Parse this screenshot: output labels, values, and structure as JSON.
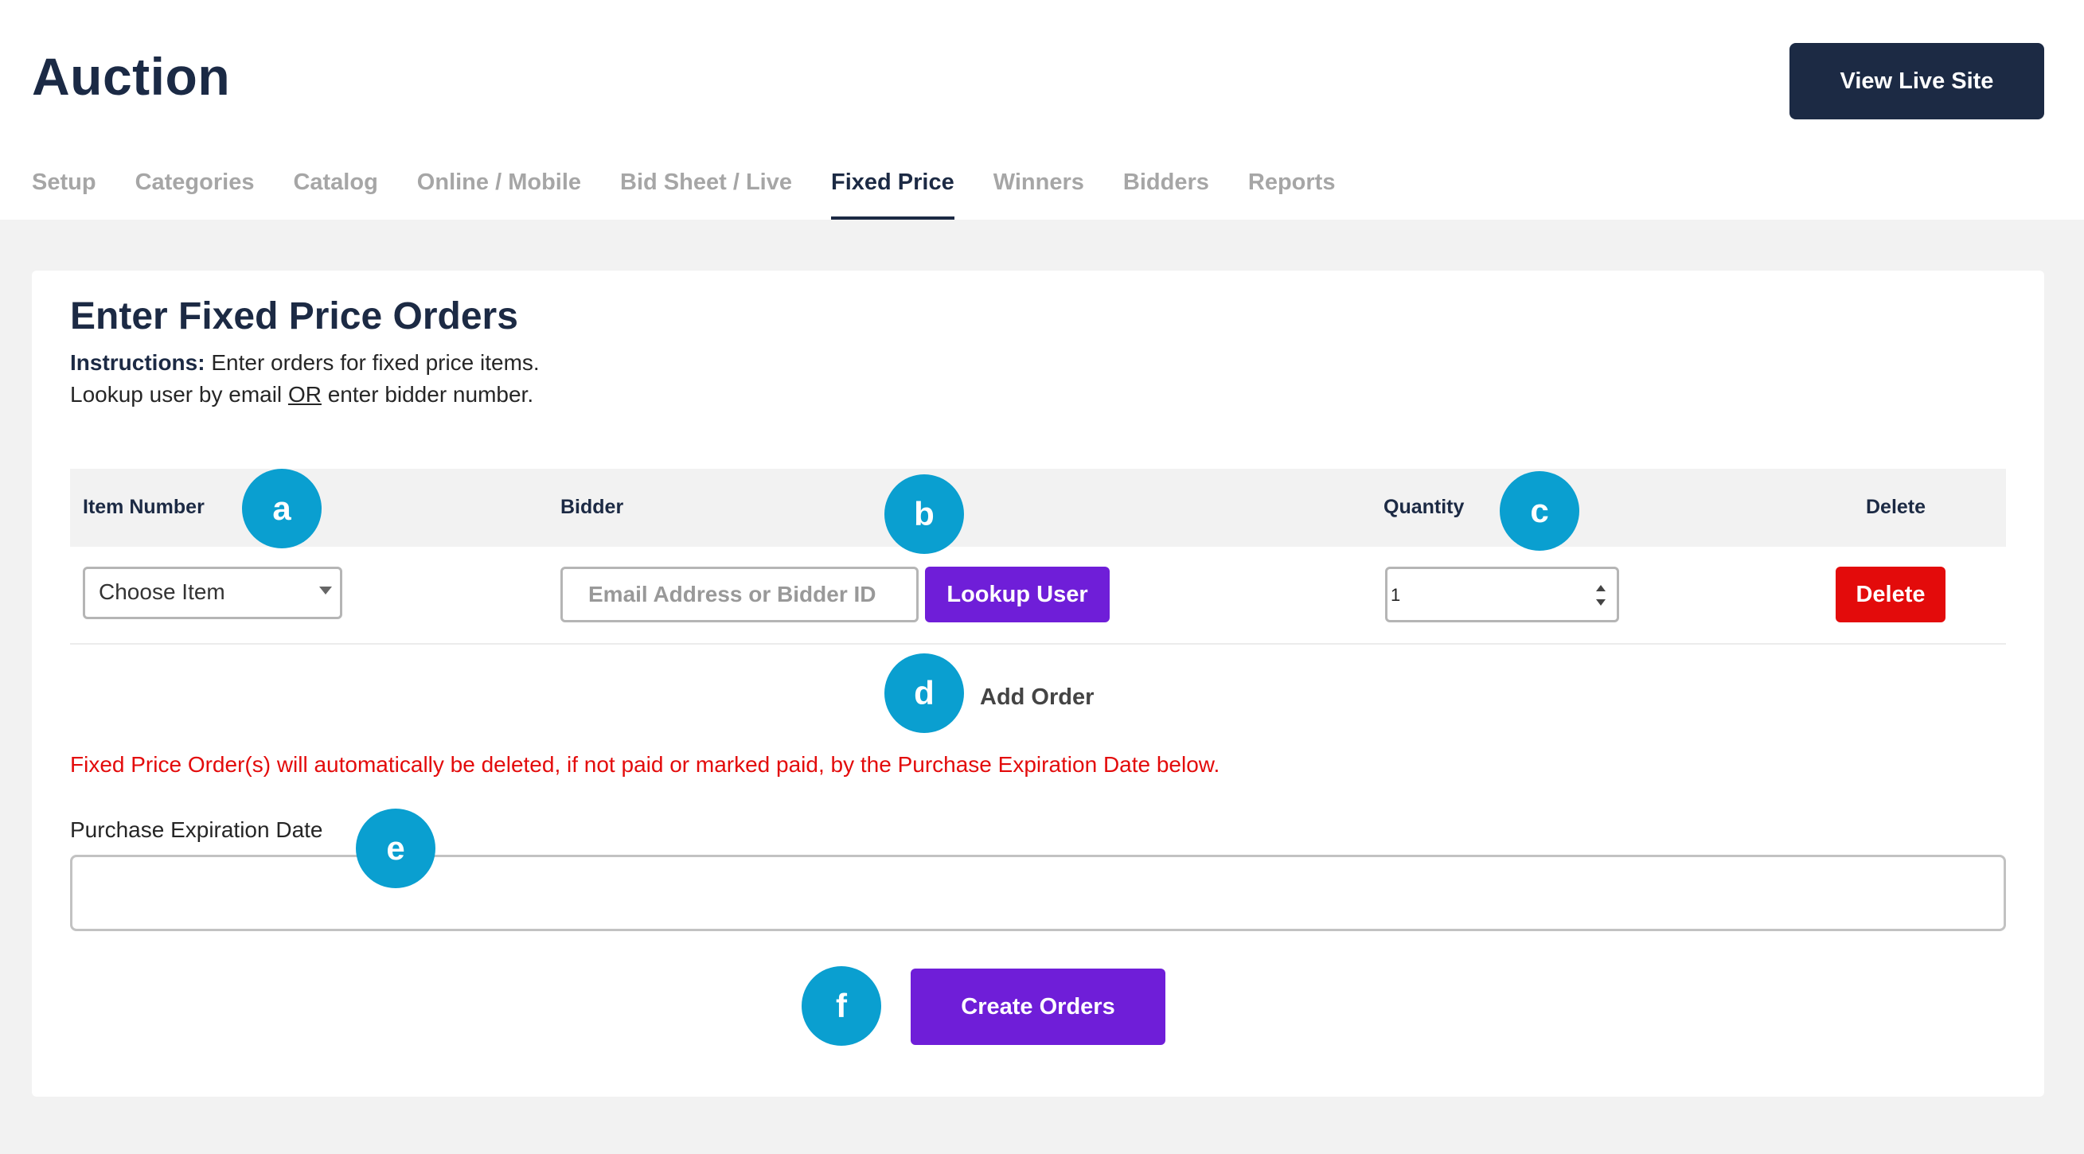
{
  "header": {
    "title": "Auction",
    "view_live_label": "View Live Site"
  },
  "tabs": [
    {
      "label": "Setup",
      "active": false
    },
    {
      "label": "Categories",
      "active": false
    },
    {
      "label": "Catalog",
      "active": false
    },
    {
      "label": "Online / Mobile",
      "active": false
    },
    {
      "label": "Bid Sheet / Live",
      "active": false
    },
    {
      "label": "Fixed Price",
      "active": true
    },
    {
      "label": "Winners",
      "active": false
    },
    {
      "label": "Bidders",
      "active": false
    },
    {
      "label": "Reports",
      "active": false
    }
  ],
  "card": {
    "title": "Enter Fixed Price Orders",
    "instructions_label": "Instructions:",
    "instructions_text": " Enter orders for fixed price items.",
    "lookup_prefix": "Lookup user by email ",
    "lookup_or": "OR",
    "lookup_suffix": " enter bidder number."
  },
  "table": {
    "headers": {
      "item_number": "Item Number",
      "bidder": "Bidder",
      "quantity": "Quantity",
      "delete": "Delete"
    },
    "row": {
      "item_select_value": "Choose Item",
      "bidder_placeholder": "Email Address or Bidder ID",
      "lookup_label": "Lookup User",
      "quantity_value": "1",
      "delete_label": "Delete"
    }
  },
  "add_order_label": "Add Order",
  "warning_text": "Fixed Price Order(s) will automatically be deleted, if not paid or marked paid, by the Purchase Expiration Date below.",
  "expiration": {
    "label": "Purchase Expiration Date",
    "value": ""
  },
  "create_orders_label": "Create Orders",
  "markers": {
    "a": "a",
    "b": "b",
    "c": "c",
    "d": "d",
    "e": "e",
    "f": "f"
  },
  "colors": {
    "navy": "#1c2a44",
    "purple": "#6f1ed8",
    "red": "#e30b0b",
    "marker_blue": "#0a9fd0"
  }
}
